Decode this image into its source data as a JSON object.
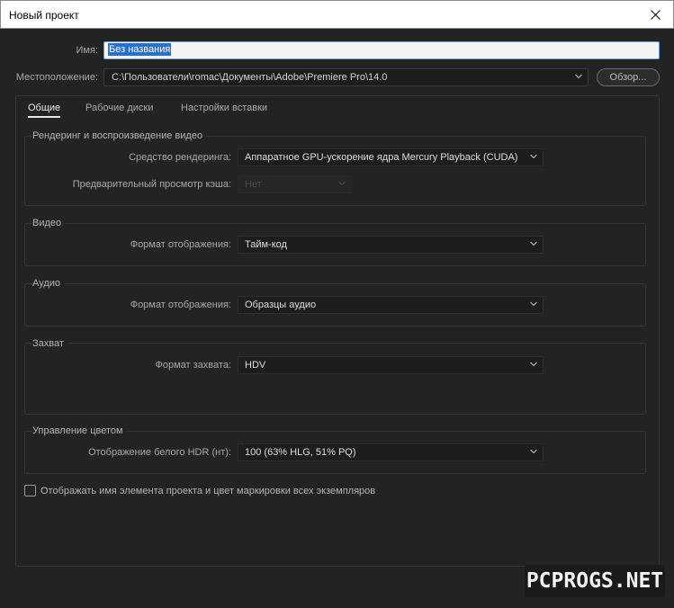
{
  "window": {
    "title": "Новый проект"
  },
  "name_label": "Имя:",
  "name_value": "Без названия",
  "location_label": "Местоположение:",
  "location_value": "C:\\Пользователи\\romac\\Документы\\Adobe\\Premiere Pro\\14.0",
  "browse_label": "Обзор...",
  "tabs": [
    {
      "label": "Общие",
      "active": true
    },
    {
      "label": "Рабочие диски",
      "active": false
    },
    {
      "label": "Настройки вставки",
      "active": false
    }
  ],
  "render_group": {
    "title": "Рендеринг и воспроизведение видео",
    "renderer_label": "Средство рендеринга:",
    "renderer_value": "Аппаратное GPU-ускорение ядра Mercury Playback (CUDA)",
    "preview_label": "Предварительный просмотр кэша:",
    "preview_value": "Нет"
  },
  "video_group": {
    "title": "Видео",
    "display_label": "Формат отображения:",
    "display_value": "Тайм-код"
  },
  "audio_group": {
    "title": "Аудио",
    "display_label": "Формат отображения:",
    "display_value": "Образцы аудио"
  },
  "capture_group": {
    "title": "Захват",
    "format_label": "Формат захвата:",
    "format_value": "HDV"
  },
  "color_group": {
    "title": "Управление цветом",
    "hdr_label": "Отображение белого HDR (нт):",
    "hdr_value": "100 (63% HLG, 51% PQ)"
  },
  "show_name_checkbox": {
    "label": "Отображать имя элемента проекта и цвет маркировки всех экземпляров",
    "checked": false
  },
  "watermark": "PCPROGS.NET",
  "colors": {
    "background": "#232323",
    "selection": "#2a6fc9",
    "text": "#c8c8c8"
  }
}
